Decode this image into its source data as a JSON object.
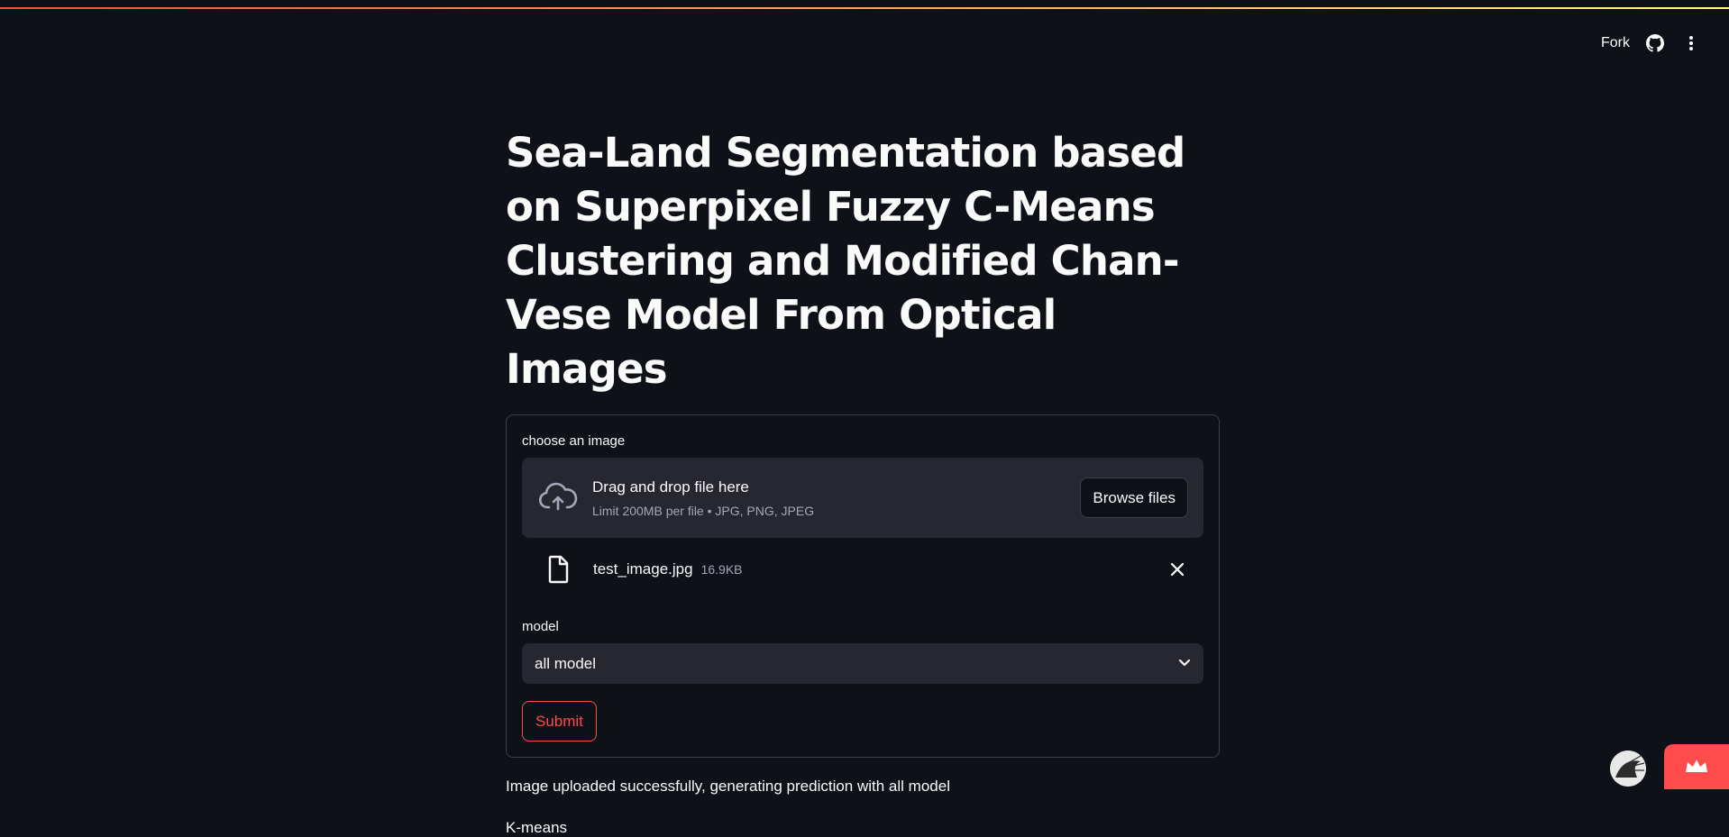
{
  "header": {
    "fork_label": "Fork",
    "github_icon": "github-icon",
    "menu_icon": "kebab-menu-icon"
  },
  "main": {
    "title": "Sea-Land Segmentation based on Superpixel Fuzzy C-Means Clustering and Modified Chan-Vese Model From Optical Images"
  },
  "uploader": {
    "label": "choose an image",
    "dropzone_title": "Drag and drop file here",
    "dropzone_subtitle": "Limit 200MB per file • JPG, PNG, JPEG",
    "browse_label": "Browse files",
    "icon": "cloud-upload-icon",
    "file": {
      "name": "test_image.jpg",
      "size": "16.9KB",
      "icon": "file-icon",
      "remove_icon": "close-icon"
    }
  },
  "model_select": {
    "label": "model",
    "value": "all model",
    "icon": "chevron-down-icon"
  },
  "submit_label": "Submit",
  "status_text": "Image uploaded successfully, generating prediction with all model",
  "section_label": "K-means",
  "colors": {
    "background": "#0e1117",
    "surface": "#262730",
    "accent": "#ff4b4b",
    "muted_text": "#a3a8b8"
  }
}
